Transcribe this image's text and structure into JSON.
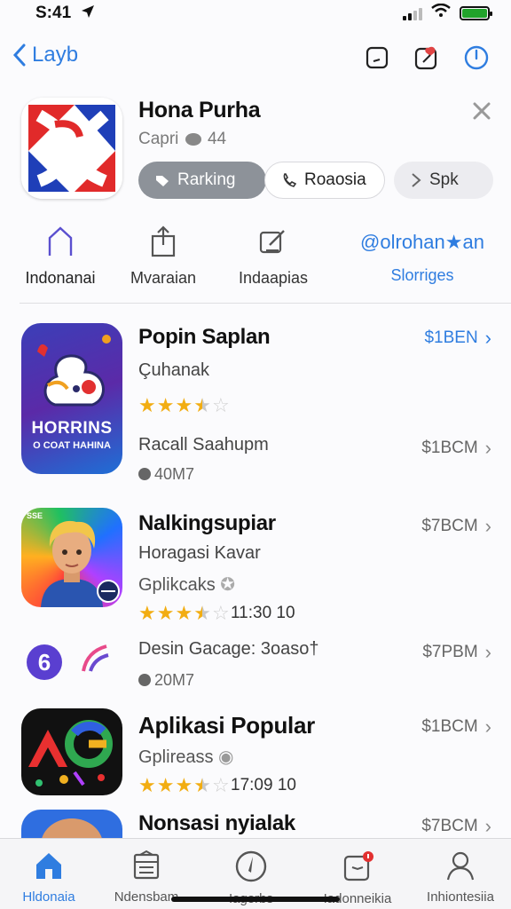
{
  "status": {
    "time": "S:41"
  },
  "nav": {
    "back_label": "Layb"
  },
  "header": {
    "title": "Hona Purha",
    "subtitle": "Capri",
    "rating_count": "44",
    "pills": [
      "Rarking",
      "Roaosia",
      "Spk"
    ]
  },
  "categories": [
    {
      "label": "Indonanai"
    },
    {
      "label": "Mvaraian"
    },
    {
      "label": "Indaapias"
    },
    {
      "title": "@olrohan★an",
      "label": "Slorriges"
    }
  ],
  "list": [
    {
      "title": "Popin Saplan",
      "subtitle": "Çuhanak",
      "line2": "Racall Saahupm",
      "meta": "40M7",
      "price": "$1BEN",
      "price2": "$1BCM",
      "icon_text_1": "HORRINS",
      "icon_text_2": "O COAT HAHINA"
    },
    {
      "title": "Nalkingsupiar",
      "subtitle": "Horagasi Kavar",
      "category": "Gplikcaks",
      "rating_meta": "11:30  10",
      "price": "$7BCM",
      "icon_badge": "SSE"
    },
    {
      "title": "Desin Gacage: 3oaso†",
      "meta": "20M7",
      "price": "$7PBM"
    },
    {
      "title": "Aplikasi Popular",
      "subtitle": "Gplireass",
      "rating_meta": "17:09  10",
      "price": "$1BCM"
    },
    {
      "title": "Nonsasi nyialak",
      "price": "$7BCM"
    }
  ],
  "tabbar": {
    "tabs": [
      {
        "label": "Hldonaia",
        "icon": "home-icon"
      },
      {
        "label": "Ndensbam",
        "icon": "list-icon"
      },
      {
        "label": "Iagorbs",
        "icon": "compass-icon"
      },
      {
        "label": "Iadonneikia",
        "icon": "inbox-icon"
      },
      {
        "label": "Inhiontesiia",
        "icon": "person-icon"
      }
    ]
  },
  "colors": {
    "accent": "#2f7de0",
    "star": "#f2ad12",
    "battery": "#21a32b"
  }
}
